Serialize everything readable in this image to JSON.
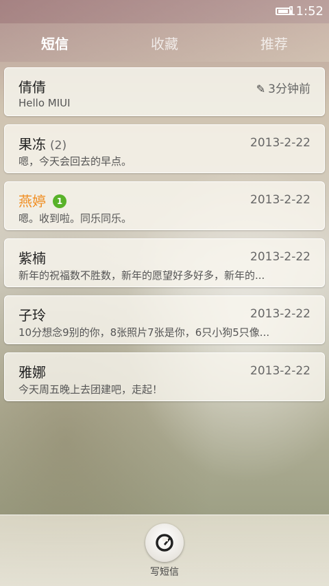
{
  "status_bar": {
    "time": "11:52",
    "battery_icon": "battery-icon"
  },
  "tabs": [
    {
      "label": "短信",
      "active": true
    },
    {
      "label": "收藏",
      "active": false
    },
    {
      "label": "推荐",
      "active": false
    }
  ],
  "conversations": [
    {
      "name": "倩倩",
      "count": "",
      "badge": "",
      "time": "3分钟前",
      "preview": "Hello MIUI",
      "draft": true,
      "unread": false
    },
    {
      "name": "果冻",
      "count": "(2)",
      "badge": "",
      "time": "2013-2-22",
      "preview": "嗯，今天会回去的早点。",
      "draft": false,
      "unread": false
    },
    {
      "name": "燕婷",
      "count": "",
      "badge": "1",
      "time": "2013-2-22",
      "preview": "嗯。收到啦。同乐同乐。",
      "draft": false,
      "unread": true
    },
    {
      "name": "紫楠",
      "count": "",
      "badge": "",
      "time": "2013-2-22",
      "preview": "新年的祝福数不胜数，新年的愿望好多好多，新年的...",
      "draft": false,
      "unread": false
    },
    {
      "name": "子玲",
      "count": "",
      "badge": "",
      "time": "2013-2-22",
      "preview": "10分想念9别的你，8张照片7张是你，6只小狗5只像...",
      "draft": false,
      "unread": false
    },
    {
      "name": "雅娜",
      "count": "",
      "badge": "",
      "time": "2013-2-22",
      "preview": "今天周五晚上去团建吧，走起！",
      "draft": false,
      "unread": false
    }
  ],
  "compose": {
    "label": "写短信",
    "icon": "compose-icon"
  },
  "colors": {
    "unread_name": "#f08c1e",
    "badge_green": "#58b229"
  }
}
